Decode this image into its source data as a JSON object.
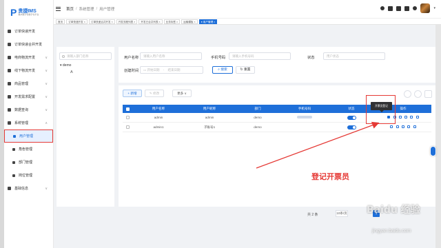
{
  "logo": {
    "mark": "P",
    "name": "贵捷IMS",
    "sub": "福州数字化数字化平台"
  },
  "sidebar": {
    "items": [
      {
        "label": "订单快递开发",
        "chevron": false
      },
      {
        "label": "订单快递合并开发",
        "chevron": false
      },
      {
        "label": "电商物流开发",
        "chevron": true
      },
      {
        "label": "线下物流开发",
        "chevron": true
      },
      {
        "label": "商品管理",
        "chevron": true
      },
      {
        "label": "开发需求配置",
        "chevron": true
      },
      {
        "label": "数据查询",
        "chevron": true
      },
      {
        "label": "系统管理",
        "chevron": true
      }
    ],
    "sub_items": [
      {
        "label": "用户管理",
        "active": true
      },
      {
        "label": "角色管理",
        "active": false
      },
      {
        "label": "部门管理",
        "active": false
      },
      {
        "label": "岗位管理",
        "active": false
      }
    ],
    "bottom_item": {
      "label": "基础信息",
      "chevron": true
    }
  },
  "header": {
    "breadcrumb": [
      "首页",
      "系统管理",
      "用户管理"
    ]
  },
  "tags": [
    "首页",
    "订单快递开发 ×",
    "订单快递合并开发 ×",
    "开发流程列表 ×",
    "开发已合并列表 ×",
    "业务标签 ×",
    "运输模板 ×",
    "● 用户管理 ×"
  ],
  "tree": {
    "search_placeholder": "请输入部门名称",
    "root": "demo",
    "child": "A"
  },
  "search": {
    "username_label": "用户名称",
    "username_placeholder": "请输入用户名称",
    "phone_label": "手机号码",
    "phone_placeholder": "请输入手机号码",
    "status_label": "状态",
    "status_placeholder": "用户状态",
    "created_label": "创建时间",
    "start_placeholder": "开始日期",
    "range_sep": "-",
    "end_placeholder": "结束日期",
    "search_btn": "搜索",
    "reset_btn": "重置"
  },
  "toolbar": {
    "add": "+ 新增",
    "edit": "修改",
    "more": "更多 ∨"
  },
  "table": {
    "columns": [
      "用户名称",
      "用户昵称",
      "部门",
      "手机号码",
      "状态",
      "操作"
    ],
    "rows": [
      {
        "username": "admin",
        "nickname": "admin",
        "dept": "demo",
        "status_on": true
      },
      {
        "username": "admin1",
        "nickname": "子账号1",
        "dept": "demo",
        "status_on": true
      }
    ]
  },
  "tooltip": "开票员登记",
  "callout": "登记开票员",
  "pagination": {
    "total": "共 2 条",
    "page_size": "10条/页",
    "current": "1"
  },
  "watermark": {
    "brand": "Baidu 经验",
    "url": "jingyan.baidu.com"
  },
  "colors": {
    "primary": "#1e6fd9",
    "annotation": "#e53935"
  }
}
